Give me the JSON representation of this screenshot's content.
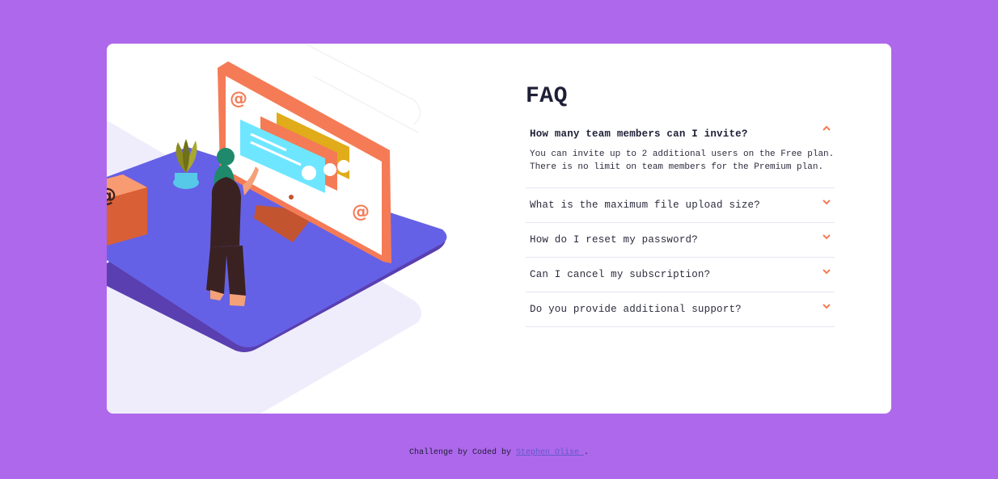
{
  "colors": {
    "page_bg": "#ae68eb",
    "card_bg": "#ffffff",
    "accent": "#f47b56",
    "platform": "#6561e6",
    "text": "#1e1f36"
  },
  "faq": {
    "title": "FAQ",
    "items": [
      {
        "question": "How many team members can I invite?",
        "answer_line1": "You can invite up to 2 additional users on the Free plan.",
        "answer_line2": "There is no limit on team members for the Premium plan.",
        "open": true,
        "icon": "chevron-up-icon"
      },
      {
        "question": "What is the maximum file upload size?",
        "open": false,
        "icon": "chevron-down-icon"
      },
      {
        "question": "How do I reset my password?",
        "open": false,
        "icon": "chevron-down-icon"
      },
      {
        "question": "Can I cancel my subscription?",
        "open": false,
        "icon": "chevron-down-icon"
      },
      {
        "question": "Do you provide additional support?",
        "open": false,
        "icon": "chevron-down-icon"
      }
    ]
  },
  "footer": {
    "prefix": "Challenge by Coded by",
    "author": "Stephen Olise ",
    "suffix": "."
  }
}
